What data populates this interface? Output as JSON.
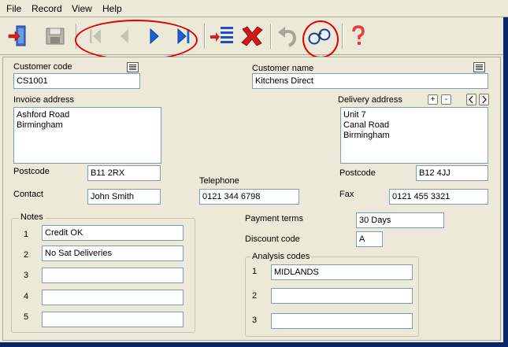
{
  "menu": {
    "file": "File",
    "record": "Record",
    "view": "View",
    "help": "Help"
  },
  "toolbar": {
    "icons": [
      "exit-door-icon",
      "save-disk-icon",
      "first-record-icon",
      "previous-record-icon",
      "next-record-icon",
      "last-record-icon",
      "insert-record-icon",
      "delete-record-icon",
      "undo-icon",
      "find-binoculars-icon",
      "help-question-icon"
    ]
  },
  "colors": {
    "accent_blue": "#1f5fd6",
    "delete_red": "#d01818",
    "annotation_red": "#e00000",
    "help_red": "#e83a3a"
  },
  "customer": {
    "code_label": "Customer code",
    "code_value": "CS1001",
    "name_label": "Customer name",
    "name_value": "Kitchens Direct"
  },
  "invoice": {
    "label": "Invoice address",
    "lines": [
      "Ashford Road",
      "Birmingham"
    ],
    "postcode_label": "Postcode",
    "postcode_value": "B11 2RX"
  },
  "delivery": {
    "label": "Delivery address",
    "add_label": "+",
    "remove_label": "-",
    "lines": [
      "Unit 7",
      "Canal Road",
      "Birmingham"
    ],
    "postcode_label": "Postcode",
    "postcode_value": "B12 4JJ"
  },
  "contact": {
    "contact_label": "Contact",
    "contact_value": "John Smith",
    "telephone_label": "Telephone",
    "telephone_value": "0121 344 6798",
    "fax_label": "Fax",
    "fax_value": "0121 455 3321"
  },
  "notes": {
    "label": "Notes",
    "rows": [
      {
        "num": "1",
        "value": "Credit OK"
      },
      {
        "num": "2",
        "value": "No Sat Deliveries"
      },
      {
        "num": "3",
        "value": ""
      },
      {
        "num": "4",
        "value": ""
      },
      {
        "num": "5",
        "value": ""
      }
    ]
  },
  "terms": {
    "payment_label": "Payment terms",
    "payment_value": "30 Days",
    "discount_label": "Discount code",
    "discount_value": "A"
  },
  "analysis": {
    "label": "Analysis codes",
    "rows": [
      {
        "num": "1",
        "value": "MIDLANDS"
      },
      {
        "num": "2",
        "value": ""
      },
      {
        "num": "3",
        "value": ""
      }
    ]
  }
}
